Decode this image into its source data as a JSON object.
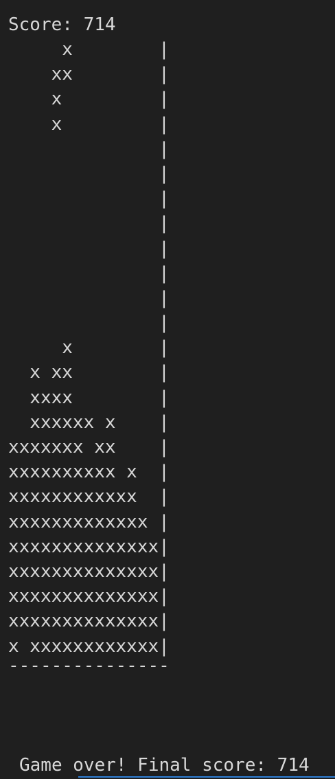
{
  "score_line": "Score: 714",
  "board": {
    "rows": [
      "     x        |",
      "    xx        |",
      "    x         |",
      "    x         |",
      "              |",
      "              |",
      "              |",
      "              |",
      "              |",
      "              |",
      "              |",
      "              |",
      "     x        |",
      "  x xx        |",
      "  xxxx        |",
      "  xxxxxx x    |",
      "xxxxxxx xx    |",
      "xxxxxxxxxx x  |",
      "xxxxxxxxxxxx  |",
      "xxxxxxxxxxxxx |",
      "xxxxxxxxxxxxxx|",
      "xxxxxxxxxxxxxx|",
      "xxxxxxxxxxxxxx|",
      "xxxxxxxxxxxxxx|",
      "x xxxxxxxxxxxx|"
    ],
    "floor": "---------------"
  },
  "game_over_line": "Game over! Final score: 714",
  "colors": {
    "background": "#1f1f1f",
    "text": "#d8d8d8",
    "accent_rule": "#2f7fd6"
  }
}
